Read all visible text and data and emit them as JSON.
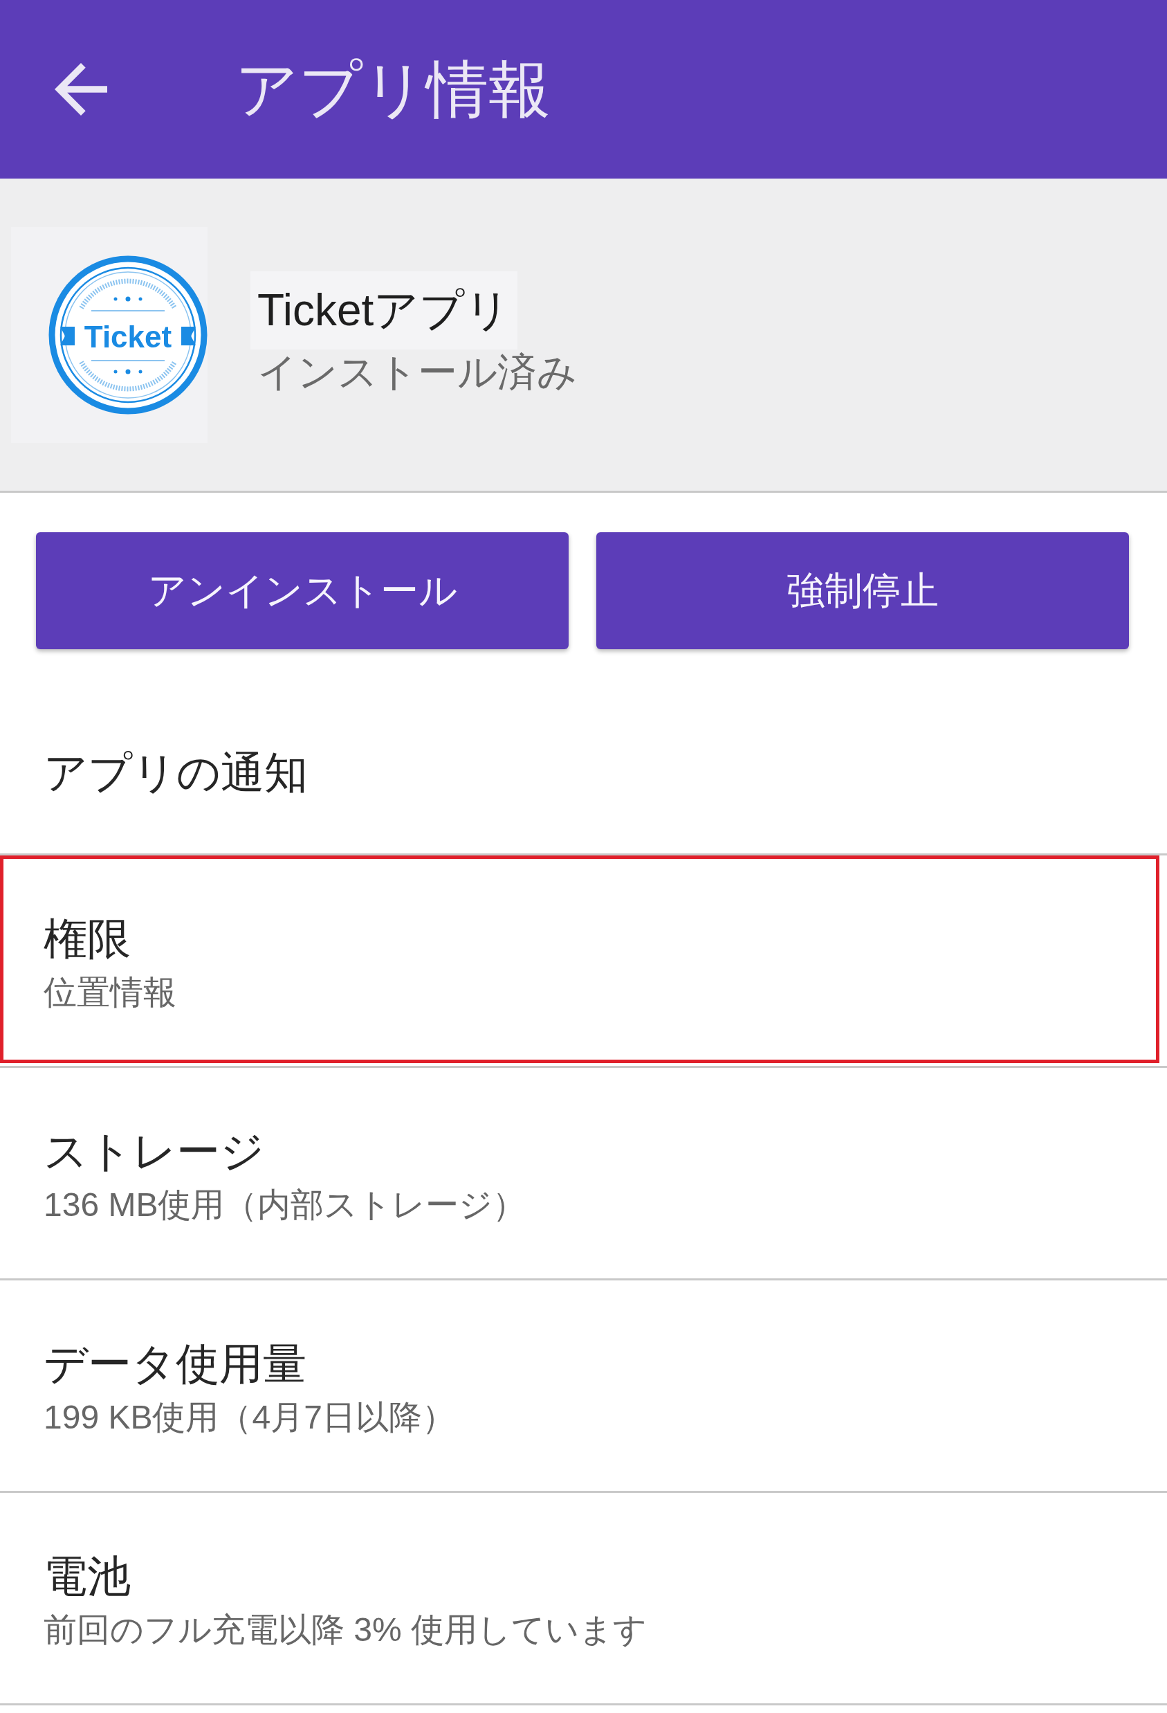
{
  "app_bar": {
    "title": "アプリ情報"
  },
  "app_header": {
    "logo_text": "Ticket",
    "name": "Ticketアプリ",
    "status": "インストール済み"
  },
  "buttons": [
    {
      "label": "アンインストール"
    },
    {
      "label": "強制停止"
    }
  ],
  "settings": [
    {
      "title": "アプリの通知",
      "highlighted": false
    },
    {
      "title": "権限",
      "summary": "位置情報",
      "highlighted": true
    },
    {
      "title": "ストレージ",
      "summary": "136 MB使用（内部ストレージ）",
      "highlighted": false
    },
    {
      "title": "データ使用量",
      "summary": "199 KB使用（4月7日以降）",
      "highlighted": false
    },
    {
      "title": "電池",
      "summary": "前回のフル充電以降 3% 使用しています",
      "highlighted": false
    }
  ]
}
